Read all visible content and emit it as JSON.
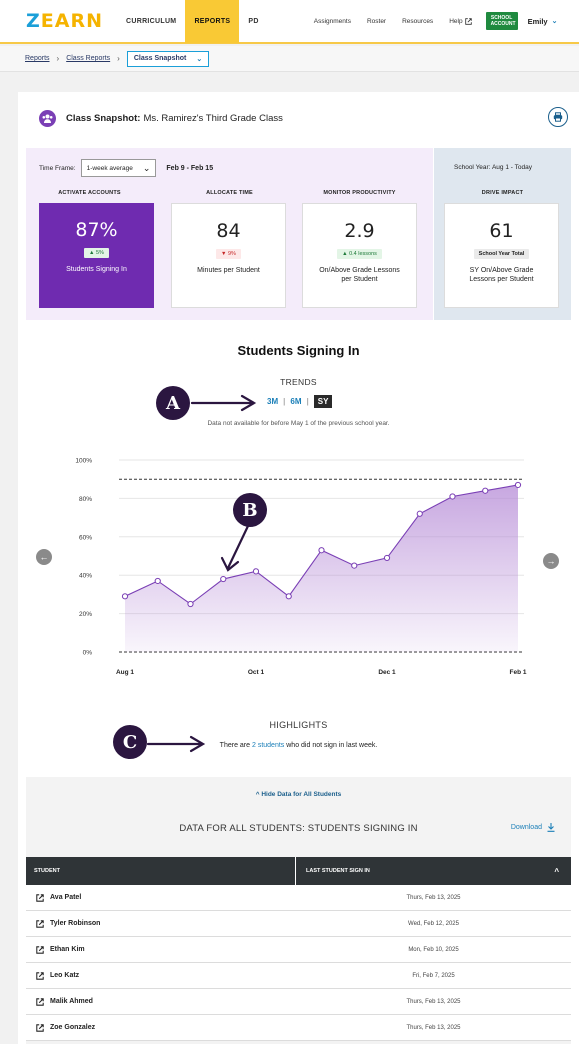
{
  "nav": {
    "logo_z": "Z",
    "logo_earn": "EARN",
    "main": [
      "CURRICULUM",
      "REPORTS",
      "PD"
    ],
    "links": [
      "Assignments",
      "Roster",
      "Resources",
      "Help"
    ],
    "school_line1": "SCHOOL",
    "school_line2": "ACCOUNT",
    "user": "Emily"
  },
  "breadcrumb": {
    "items": [
      "Reports",
      "Class Reports"
    ],
    "current": "Class Snapshot"
  },
  "snapshot": {
    "label": "Class Snapshot:",
    "class_name": "Ms. Ramirez's Third Grade Class"
  },
  "timeframe": {
    "label": "Time Frame:",
    "value": "1-week average",
    "dates": "Feb 9 - Feb 15"
  },
  "school_year": {
    "label": "School Year:",
    "value": "Aug 1 - Today"
  },
  "metrics": [
    {
      "heading": "ACTIVATE ACCOUNTS",
      "value": "87%",
      "badge": "▲ 5%",
      "label": "Students Signing In"
    },
    {
      "heading": "ALLOCATE TIME",
      "value": "84",
      "badge": "▼ 9%",
      "label": "Minutes per Student"
    },
    {
      "heading": "MONITOR PRODUCTIVITY",
      "value": "2.9",
      "badge": "▲ 0.4 lessons",
      "label": "On/Above Grade Lessons per Student"
    },
    {
      "heading": "DRIVE IMPACT",
      "value": "61",
      "badge": "School Year Total",
      "label": "SY On/Above Grade Lessons per Student"
    }
  ],
  "chart_section": {
    "title": "Students Signing In",
    "trends_label": "TRENDS",
    "ranges": [
      "3M",
      "6M",
      "SY"
    ],
    "selected_range": "SY",
    "note": "Data not available for before May 1 of the previous school year."
  },
  "callouts": [
    "A",
    "B",
    "C"
  ],
  "chart_data": {
    "type": "area",
    "title": "",
    "xlabel": "",
    "ylabel": "",
    "x_ticks": [
      "Aug 1",
      "Oct 1",
      "Dec 1",
      "Feb 1"
    ],
    "y_ticks": [
      "100%",
      "80%",
      "60%",
      "40%",
      "20%",
      "0%"
    ],
    "ylim": [
      0,
      100
    ],
    "reference_line": 90,
    "series": [
      {
        "values": [
          29,
          37,
          25,
          38,
          42,
          29,
          53,
          45,
          49,
          72,
          81,
          84,
          87
        ]
      }
    ]
  },
  "highlights": {
    "title": "HIGHLIGHTS",
    "pre": "There are",
    "link": "2 students",
    "post": "who did not sign in last week."
  },
  "data_section": {
    "hide_link": "Hide Data for All Students",
    "title": "DATA FOR ALL STUDENTS: STUDENTS SIGNING IN",
    "download": "Download",
    "columns": [
      "STUDENT",
      "LAST STUDENT SIGN IN"
    ],
    "rows": [
      {
        "name": "Ava Patel",
        "date": "Thurs, Feb 13, 2025"
      },
      {
        "name": "Tyler Robinson",
        "date": "Wed, Feb 12, 2025"
      },
      {
        "name": "Ethan Kim",
        "date": "Mon, Feb 10, 2025"
      },
      {
        "name": "Leo Katz",
        "date": "Fri, Feb 7, 2025"
      },
      {
        "name": "Malik Ahmed",
        "date": "Thurs, Feb 13, 2025"
      },
      {
        "name": "Zoe Gonzalez",
        "date": "Thurs, Feb 13, 2025"
      }
    ]
  },
  "colors": {
    "accent_yellow": "#f9c935",
    "brand_purple": "#6f2bb0",
    "link_blue": "#1b7fb8",
    "chart_fill": "#b58ad6",
    "chart_line": "#7a3fb5"
  }
}
